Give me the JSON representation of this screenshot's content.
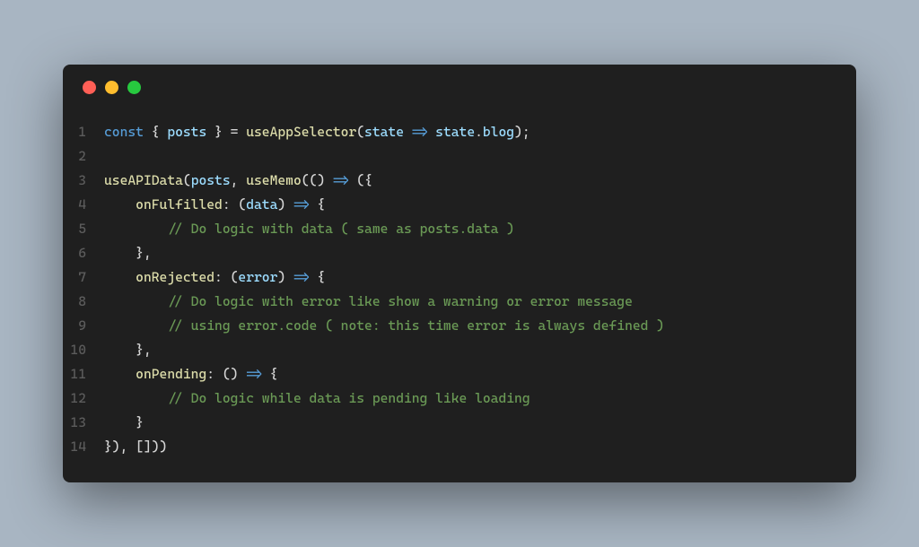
{
  "window": {
    "dotColors": {
      "red": "#ff5f56",
      "yellow": "#ffbd2e",
      "green": "#27c93f"
    }
  },
  "code": {
    "lines": [
      {
        "num": "1",
        "tokens": [
          {
            "t": "const ",
            "c": "kw"
          },
          {
            "t": "{ ",
            "c": "punct"
          },
          {
            "t": "posts ",
            "c": "var"
          },
          {
            "t": "} ",
            "c": "punct"
          },
          {
            "t": "= ",
            "c": "op"
          },
          {
            "t": "useAppSelector",
            "c": "fn"
          },
          {
            "t": "(",
            "c": "punct"
          },
          {
            "t": "state ",
            "c": "param"
          },
          {
            "t": "=> ",
            "c": "kw"
          },
          {
            "t": "state",
            "c": "param"
          },
          {
            "t": ".",
            "c": "punct"
          },
          {
            "t": "blog",
            "c": "param"
          },
          {
            "t": ");",
            "c": "punct"
          }
        ]
      },
      {
        "num": "2",
        "tokens": []
      },
      {
        "num": "3",
        "tokens": [
          {
            "t": "useAPIData",
            "c": "fn"
          },
          {
            "t": "(",
            "c": "punct"
          },
          {
            "t": "posts",
            "c": "var"
          },
          {
            "t": ", ",
            "c": "punct"
          },
          {
            "t": "useMemo",
            "c": "fn"
          },
          {
            "t": "(() ",
            "c": "punct"
          },
          {
            "t": "=> ",
            "c": "kw"
          },
          {
            "t": "({",
            "c": "punct"
          }
        ]
      },
      {
        "num": "4",
        "tokens": [
          {
            "t": "    ",
            "c": ""
          },
          {
            "t": "onFulfilled",
            "c": "prop"
          },
          {
            "t": ": (",
            "c": "punct"
          },
          {
            "t": "data",
            "c": "param"
          },
          {
            "t": ") ",
            "c": "punct"
          },
          {
            "t": "=> ",
            "c": "kw"
          },
          {
            "t": "{",
            "c": "punct"
          }
        ]
      },
      {
        "num": "5",
        "tokens": [
          {
            "t": "        ",
            "c": ""
          },
          {
            "t": "// Do logic with data ( same as posts.data )",
            "c": "comment"
          }
        ]
      },
      {
        "num": "6",
        "tokens": [
          {
            "t": "    },",
            "c": "punct"
          }
        ]
      },
      {
        "num": "7",
        "tokens": [
          {
            "t": "    ",
            "c": ""
          },
          {
            "t": "onRejected",
            "c": "prop"
          },
          {
            "t": ": (",
            "c": "punct"
          },
          {
            "t": "error",
            "c": "param"
          },
          {
            "t": ") ",
            "c": "punct"
          },
          {
            "t": "=> ",
            "c": "kw"
          },
          {
            "t": "{",
            "c": "punct"
          }
        ]
      },
      {
        "num": "8",
        "tokens": [
          {
            "t": "        ",
            "c": ""
          },
          {
            "t": "// Do logic with error like show a warning or error message",
            "c": "comment"
          }
        ]
      },
      {
        "num": "9",
        "tokens": [
          {
            "t": "        ",
            "c": ""
          },
          {
            "t": "// using error.code ( note: this time error is always defined )",
            "c": "comment"
          }
        ]
      },
      {
        "num": "10",
        "tokens": [
          {
            "t": "    },",
            "c": "punct"
          }
        ]
      },
      {
        "num": "11",
        "tokens": [
          {
            "t": "    ",
            "c": ""
          },
          {
            "t": "onPending",
            "c": "prop"
          },
          {
            "t": ": () ",
            "c": "punct"
          },
          {
            "t": "=> ",
            "c": "kw"
          },
          {
            "t": "{",
            "c": "punct"
          }
        ]
      },
      {
        "num": "12",
        "tokens": [
          {
            "t": "        ",
            "c": ""
          },
          {
            "t": "// Do logic while data is pending like loading",
            "c": "comment"
          }
        ]
      },
      {
        "num": "13",
        "tokens": [
          {
            "t": "    }",
            "c": "punct"
          }
        ]
      },
      {
        "num": "14",
        "tokens": [
          {
            "t": "}), []))",
            "c": "punct"
          }
        ]
      }
    ]
  }
}
